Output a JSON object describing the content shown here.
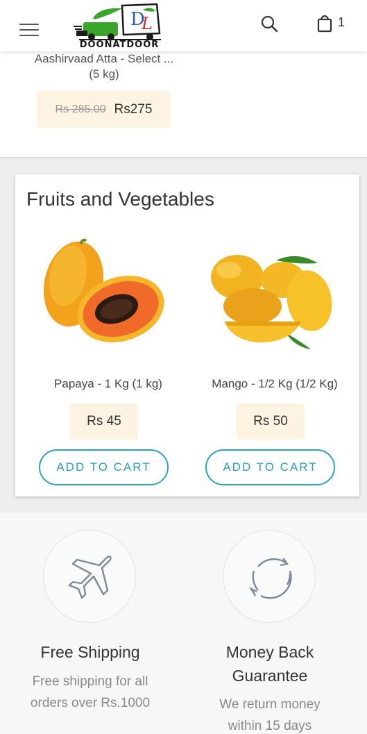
{
  "header": {
    "brand": "DOONATDOOR",
    "cart_count": "1"
  },
  "previous_product": {
    "title_line1": "Aashirvaad Atta - Select ...",
    "title_line2": "(5 kg)",
    "old_price": "Rs 285.00",
    "price": "Rs275"
  },
  "fruits_section": {
    "title": "Fruits and Vegetables",
    "products": [
      {
        "name": "Papaya - 1 Kg (1 kg)",
        "price": "Rs 45",
        "button": "ADD TO CART"
      },
      {
        "name": "Mango - 1/2 Kg (1/2 Kg)",
        "price": "Rs 50",
        "button": "ADD TO CART"
      }
    ]
  },
  "features": [
    {
      "icon": "airplane-icon",
      "title": "Free Shipping",
      "desc_line1": "Free shipping for all",
      "desc_line2": "orders over Rs.1000"
    },
    {
      "icon": "refresh-icon",
      "title_line1": "Money Back",
      "title_line2": "Guarantee",
      "desc_line1": "We return money",
      "desc_line2": "within 15 days"
    }
  ],
  "colors": {
    "accent": "#2aa3c2",
    "price_bg": "#fdf3e1",
    "logo_green": "#3aa52a",
    "logo_red": "#d9262a",
    "logo_blue": "#2a5ab8"
  }
}
